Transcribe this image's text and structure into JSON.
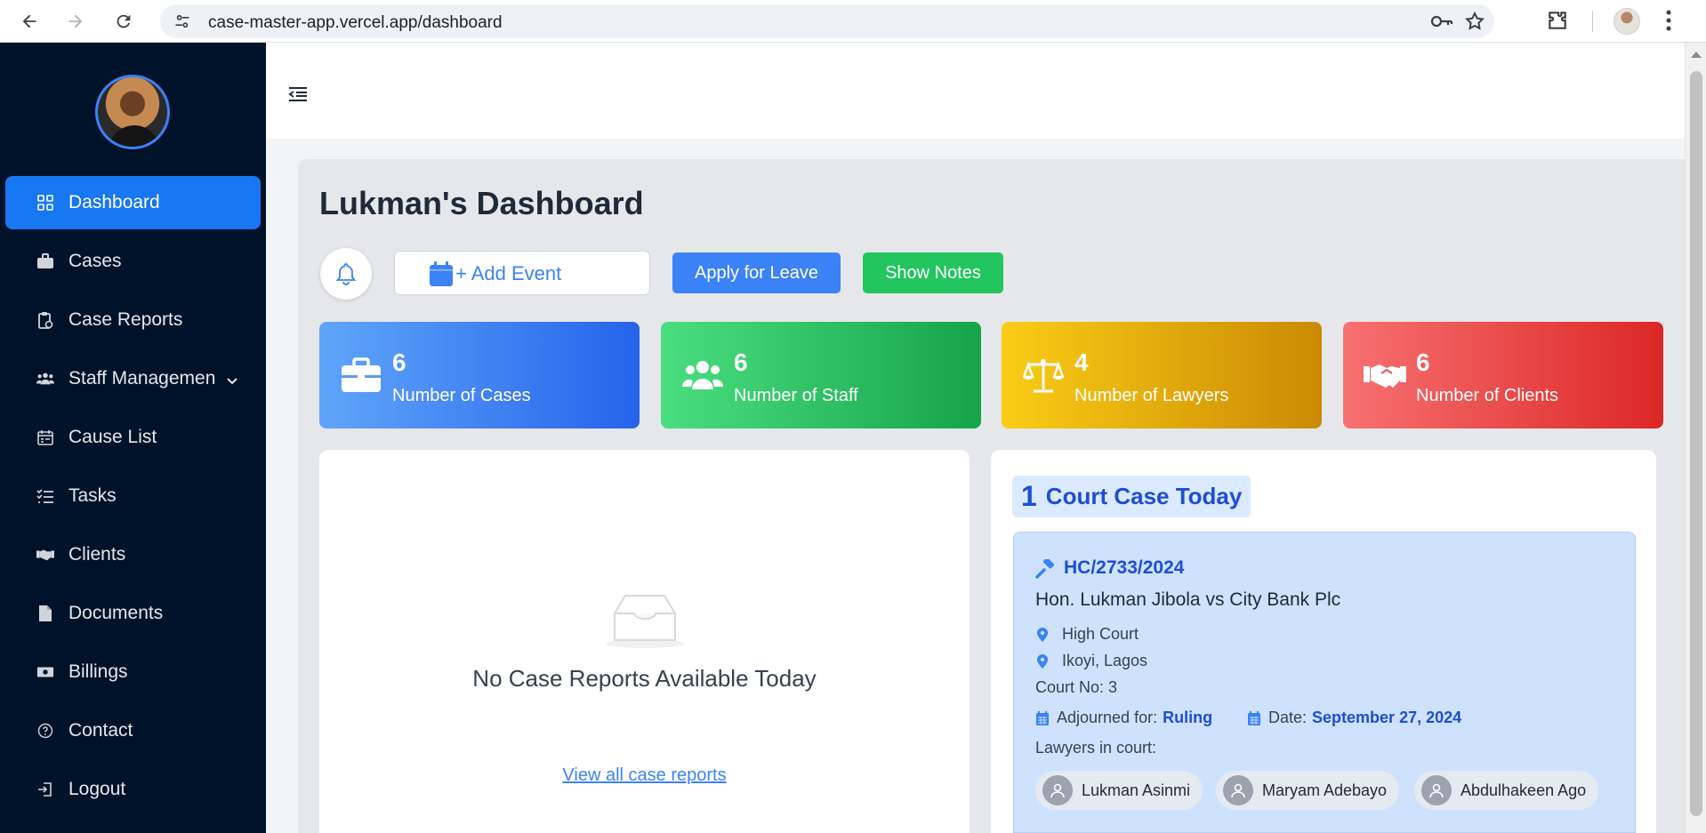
{
  "browser": {
    "url": "case-master-app.vercel.app/dashboard"
  },
  "sidebar": {
    "items": [
      {
        "label": "Dashboard",
        "icon": "grid-icon",
        "active": true
      },
      {
        "label": "Cases",
        "icon": "briefcase-icon"
      },
      {
        "label": "Case Reports",
        "icon": "report-icon"
      },
      {
        "label": "Staff Managemen",
        "icon": "users-icon",
        "has_submenu": true
      },
      {
        "label": "Cause List",
        "icon": "calendar-list-icon"
      },
      {
        "label": "Tasks",
        "icon": "tasks-icon"
      },
      {
        "label": "Clients",
        "icon": "handshake-icon"
      },
      {
        "label": "Documents",
        "icon": "document-icon"
      },
      {
        "label": "Billings",
        "icon": "money-icon"
      },
      {
        "label": "Contact",
        "icon": "question-circle-icon"
      },
      {
        "label": "Logout",
        "icon": "logout-icon"
      }
    ]
  },
  "main": {
    "title": "Lukman's Dashboard",
    "actions": {
      "add_event": "+ Add Event",
      "apply_leave": "Apply for Leave",
      "show_notes": "Show Notes"
    },
    "stats": [
      {
        "value": "6",
        "label": "Number of Cases",
        "icon": "briefcase-icon"
      },
      {
        "value": "6",
        "label": "Number of Staff",
        "icon": "users-icon"
      },
      {
        "value": "4",
        "label": "Number of Lawyers",
        "icon": "scales-icon"
      },
      {
        "value": "6",
        "label": "Number of Clients",
        "icon": "handshake-icon"
      }
    ],
    "reports": {
      "empty_text": "No Case Reports Available Today",
      "link": "View all case reports"
    },
    "court_today": {
      "count": "1",
      "title": "Court Case Today",
      "case": {
        "number": "HC/2733/2024",
        "title": "Hon. Lukman Jibola vs City Bank Plc",
        "court": "High Court",
        "location": "Ikoyi, Lagos",
        "court_no": "Court No: 3",
        "adjourned_label": "Adjourned for:",
        "adjourned_for": "Ruling",
        "date_label": "Date:",
        "date": "September 27, 2024",
        "lawyers_label": "Lawyers in court:",
        "lawyers": [
          "Lukman Asinmi",
          "Maryam Adebayo",
          "Abdulhakeen Ago"
        ]
      }
    }
  },
  "colors": {
    "sidebar_bg": "#001229",
    "active_nav": "#1877f2",
    "primary": "#3b82f6",
    "success": "#22c55e",
    "warning": "#ca8a04",
    "danger": "#dc2626"
  }
}
